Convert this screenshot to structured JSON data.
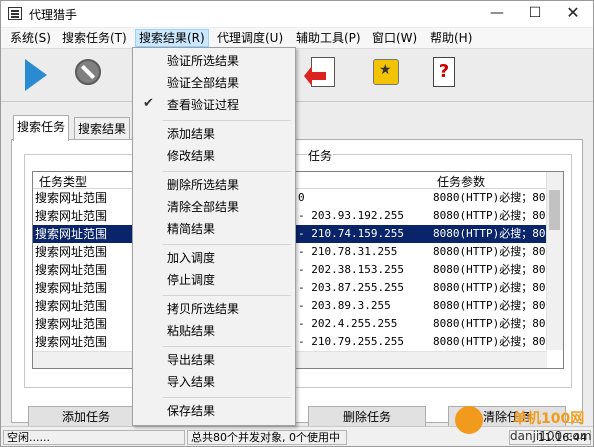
{
  "window": {
    "title": "代理猎手"
  },
  "menu": [
    "系统(S)",
    "搜索任务(T)",
    "搜索结果(R)",
    "代理调度(U)",
    "辅助工具(P)",
    "窗口(W)",
    "帮助(H)"
  ],
  "tabs": [
    "搜索任务",
    "搜索结果"
  ],
  "group_label": "任务",
  "columns": {
    "type": "任务类型",
    "params": "任务参数"
  },
  "rows": [
    {
      "type": "搜索网址范围",
      "range": "0",
      "params": "8080(HTTP)必搜；80("
    },
    {
      "type": "搜索网址范围",
      "range": "- 203.93.192.255",
      "params": "8080(HTTP)必搜；80("
    },
    {
      "type": "搜索网址范围",
      "range": "- 210.74.159.255",
      "params": "8080(HTTP)必搜；80(",
      "selected": true
    },
    {
      "type": "搜索网址范围",
      "range": "- 210.78.31.255",
      "params": "8080(HTTP)必搜；80("
    },
    {
      "type": "搜索网址范围",
      "range": "- 202.38.153.255",
      "params": "8080(HTTP)必搜；80("
    },
    {
      "type": "搜索网址范围",
      "range": "- 203.87.255.255",
      "params": "8080(HTTP)必搜；80("
    },
    {
      "type": "搜索网址范围",
      "range": "- 203.89.3.255",
      "params": "8080(HTTP)必搜；80("
    },
    {
      "type": "搜索网址范围",
      "range": "- 202.4.255.255",
      "params": "8080(HTTP)必搜；80("
    },
    {
      "type": "搜索网址范围",
      "range": "- 210.79.255.255",
      "params": "8080(HTTP)必搜；80("
    },
    {
      "type": "搜索网址范围",
      "range": "- 202.95.7.255",
      "params": "8080(HTTP)必搜；80("
    }
  ],
  "buttons": {
    "add": "添加任务",
    "delete": "删除任务",
    "clear": "清除任务"
  },
  "dropdown": [
    "验证所选结果",
    "验证全部结果",
    "查看验证过程",
    "添加结果",
    "修改结果",
    "删除所选结果",
    "清除全部结果",
    "精简结果",
    "加入调度",
    "停止调度",
    "拷贝所选结果",
    "粘贴结果",
    "导出结果",
    "导入结果",
    "保存结果"
  ],
  "status": {
    "left": "空闲......",
    "middle": "总共80个并发对象, 0个使用中",
    "time": "11:16:44"
  },
  "watermark": {
    "brand": "单机100网",
    "domain": "danji100.com"
  }
}
